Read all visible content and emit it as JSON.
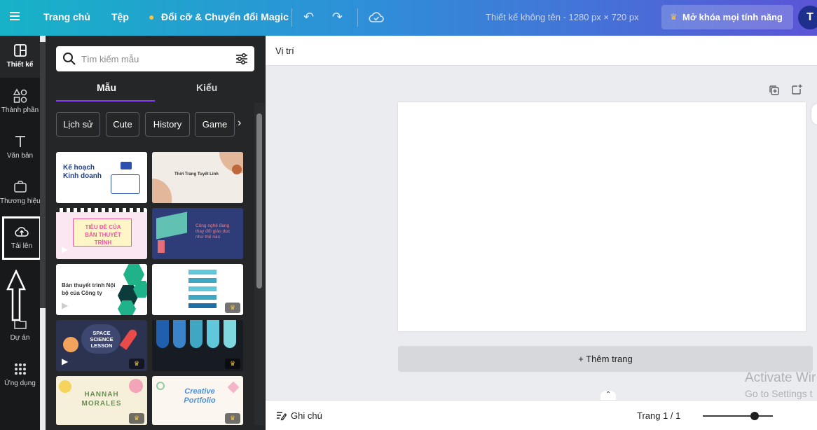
{
  "topbar": {
    "home": "Trang chủ",
    "file": "Tệp",
    "resize": "Đổi cỡ & Chuyển đổi Magic",
    "design_title": "Thiết kế không tên - 1280 px × 720 px",
    "unlock": "Mở khóa mọi tính năng",
    "avatar": "T"
  },
  "rail": {
    "items": [
      {
        "label": "Thiết kế",
        "icon": "layout-icon"
      },
      {
        "label": "Thành phần",
        "icon": "shapes-icon"
      },
      {
        "label": "Văn bản",
        "icon": "text-icon"
      },
      {
        "label": "Thương hiệu",
        "icon": "brand-icon"
      },
      {
        "label": "Tải lên",
        "icon": "upload-icon"
      },
      {
        "label": "Dự án",
        "icon": "folder-icon"
      },
      {
        "label": "Ứng dụng",
        "icon": "apps-icon"
      }
    ]
  },
  "panel": {
    "search_placeholder": "Tìm kiếm mẫu",
    "tabs": [
      "Mẫu",
      "Kiểu"
    ],
    "chips": [
      "Lịch sử",
      "Cute",
      "History",
      "Game"
    ],
    "thumbs": [
      {
        "text": "Kế hoạch Kinh doanh"
      },
      {
        "text": "Thời Trang Tuyết Linh"
      },
      {
        "text": "TIÊU ĐỀ CỦA BẢN THUYẾT TRÌNH"
      },
      {
        "text": "Công nghệ đang thay đổi giáo dục như thế nào"
      },
      {
        "text": "Bản thuyết trình Nội bộ của Công ty"
      },
      {
        "text": ""
      },
      {
        "text": "SPACE SCIENCE LESSON"
      },
      {
        "text": ""
      },
      {
        "text": "HANNAH MORALES"
      },
      {
        "text": "Creative Portfolio"
      }
    ]
  },
  "canvas": {
    "position_label": "Vị trí",
    "add_page": "+ Thêm trang",
    "notes": "Ghi chú",
    "page_info": "Trang 1 / 1",
    "watermark_title": "Activate Wir",
    "watermark_sub": "Go to Settings t"
  },
  "colors": {
    "accent": "#8b3dff",
    "panel": "#252627",
    "rail": "#18191b"
  }
}
